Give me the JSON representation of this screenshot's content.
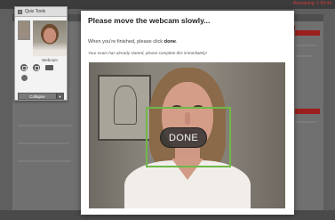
{
  "app": {
    "top_right_text": "Remaining: 1:59:44"
  },
  "quiz_tools": {
    "title": "Quiz Tools",
    "cam_label": "Webcam",
    "collapse_label": "Collapse",
    "icons": [
      "grid-icon",
      "audio-icon",
      "screen-icon",
      "camera-icon",
      "settings-icon",
      "chevron-down-icon"
    ]
  },
  "modal": {
    "title": "Please move the webcam slowly...",
    "instruction_prefix": "When you're finished, please click",
    "instruction_action": "done",
    "instruction_suffix": ".",
    "warning": "Your exam has already started, please complete this immediately!",
    "done_label": "DONE"
  },
  "colors": {
    "overlay_green": "#6fb84a",
    "accent_red": "#9c1e1e",
    "done_bg": "#323232"
  }
}
